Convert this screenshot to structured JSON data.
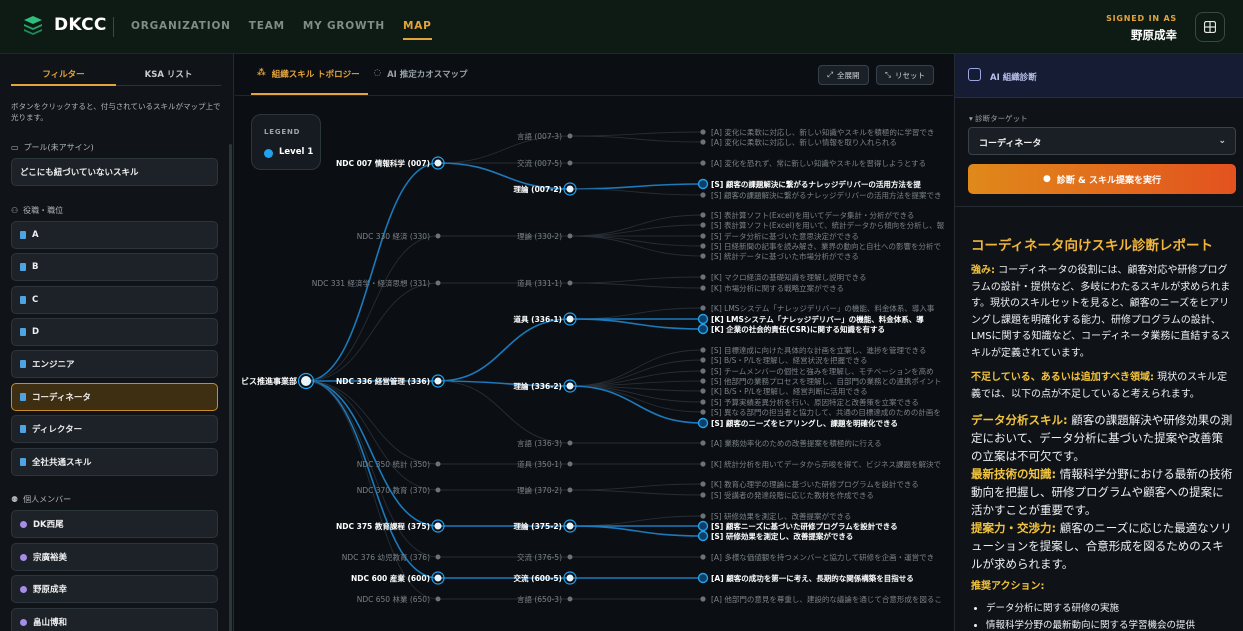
{
  "app": {
    "brand": "DKCC",
    "nav": [
      "ORGANIZATION",
      "TEAM",
      "MY GROWTH",
      "MAP"
    ],
    "active_nav": "MAP",
    "signed_in_label": "SIGNED IN AS",
    "user_name": "野原成幸"
  },
  "sidebar": {
    "tabs": [
      "フィルター",
      "KSA リスト"
    ],
    "help": "ボタンをクリックすると、付与されているスキルがマップ上で光ります。",
    "pool_label": "プール(未アサイン)",
    "pool_item": "どこにも紐づいていないスキル",
    "roles_label": "役職・職位",
    "roles": [
      "A",
      "B",
      "C",
      "D",
      "エンジニア",
      "コーディネータ",
      "ディレクター",
      "全社共通スキル"
    ],
    "selected_role": "コーディネータ",
    "members_label": "個人メンバー",
    "members": [
      "DK西尾",
      "宗廣裕美",
      "野原成幸",
      "畠山博和"
    ]
  },
  "main": {
    "tabs": [
      "組織スキル トポロジー",
      "AI 推定カオスマップ"
    ],
    "buttons": {
      "overview": "全展開",
      "reset": "リセット"
    },
    "legend_title": "LEGEND",
    "legend_item": "Level 1"
  },
  "graph": {
    "root": "ビス推進事業部",
    "l1": [
      {
        "label": "NDC 007 情報科学 (007)",
        "bold": true
      },
      {
        "label": "NDC 330 経済 (330)",
        "bold": false
      },
      {
        "label": "NDC 331 経済学・経済思想 (331)",
        "bold": false
      },
      {
        "label": "NDC 336 経営管理 (336)",
        "bold": true
      },
      {
        "label": "NDC 350 統計 (350)",
        "bold": false
      },
      {
        "label": "NDC 370 教育 (370)",
        "bold": false
      },
      {
        "label": "NDC 375 教育課程 (375)",
        "bold": true
      },
      {
        "label": "NDC 376 幼児教育 (376)",
        "bold": false
      },
      {
        "label": "NDC 600 産業 (600)",
        "bold": true
      },
      {
        "label": "NDC 650 林業 (650)",
        "bold": false
      }
    ],
    "l2": [
      {
        "label": "言語 (007-3)",
        "bold": false
      },
      {
        "label": "交流 (007-5)",
        "bold": false
      },
      {
        "label": "理論 (007-2)",
        "bold": true
      },
      {
        "label": "理論 (330-2)",
        "bold": false
      },
      {
        "label": "道具 (331-1)",
        "bold": false
      },
      {
        "label": "道具 (336-1)",
        "bold": true
      },
      {
        "label": "理論 (336-2)",
        "bold": true
      },
      {
        "label": "言語 (336-3)",
        "bold": false
      },
      {
        "label": "道具 (350-1)",
        "bold": false
      },
      {
        "label": "理論 (370-2)",
        "bold": false
      },
      {
        "label": "理論 (375-2)",
        "bold": true
      },
      {
        "label": "交流 (376-5)",
        "bold": false
      },
      {
        "label": "交流 (600-5)",
        "bold": true
      },
      {
        "label": "言語 (650-3)",
        "bold": false
      }
    ],
    "leaves": [
      {
        "label": "[A] 変化に柔軟に対応し、新しい知識やスキルを積極的に学習でき",
        "bold": false
      },
      {
        "label": "[A] 変化に柔軟に対応し、新しい情報を取り入れられる",
        "bold": false
      },
      {
        "label": "[A] 変化を恐れず、常に新しい知識やスキルを習得しようとする",
        "bold": false
      },
      {
        "label": "[S] 顧客の課題解決に繋がるナレッジデリバーの活用方法を提",
        "bold": true
      },
      {
        "label": "[S] 顧客の課題解決に繋がるナレッジデリバーの活用方法を提案でき",
        "bold": false
      },
      {
        "label": "[S] 表計算ソフト(Excel)を用いてデータ集計・分析ができる",
        "bold": false
      },
      {
        "label": "[S] 表計算ソフト(Excel)を用いて、統計データから傾向を分析し、報",
        "bold": false
      },
      {
        "label": "[S] データ分析に基づいた意思決定ができる",
        "bold": false
      },
      {
        "label": "[S] 日経新聞の記事を読み解き、業界の動向と自社への影響を分析で",
        "bold": false
      },
      {
        "label": "[S] 統計データに基づいた市場分析ができる",
        "bold": false
      },
      {
        "label": "[K] マクロ経済の基礎知識を理解し説明できる",
        "bold": false
      },
      {
        "label": "[K] 市場分析に関する戦略立案ができる",
        "bold": false
      },
      {
        "label": "[K] LMSシステム「ナレッジデリバー」の機能、料金体系、導入事",
        "bold": false
      },
      {
        "label": "[K] LMSシステム「ナレッジデリバー」の機能、料金体系、導",
        "bold": true
      },
      {
        "label": "[K] 企業の社会的責任(CSR)に関する知識を有する",
        "bold": true
      },
      {
        "label": "[S] 目標達成に向けた具体的な計画を立案し、進捗を管理できる",
        "bold": false
      },
      {
        "label": "[S] B/S・P/Lを理解し、経営状況を把握できる",
        "bold": false
      },
      {
        "label": "[S] チームメンバーの個性と強みを理解し、モチベーションを高め",
        "bold": false
      },
      {
        "label": "[S] 他部門の業務プロセスを理解し、自部門の業務との連携ポイント",
        "bold": false
      },
      {
        "label": "[K] B/S・P/Lを理解し、経営判断に活用できる",
        "bold": false
      },
      {
        "label": "[S] 予算実績差異分析を行い、原因特定と改善策を立案できる",
        "bold": false
      },
      {
        "label": "[S] 異なる部門の担当者と協力して、共通の目標達成のための計画を",
        "bold": false
      },
      {
        "label": "[S] 顧客のニーズをヒアリングし、課題を明確化できる",
        "bold": true
      },
      {
        "label": "[A] 業務効率化のための改善提案を積極的に行える",
        "bold": false
      },
      {
        "label": "[K] 統計分析を用いてデータから示唆を得て、ビジネス課題を解決で",
        "bold": false
      },
      {
        "label": "[K] 教育心理学の理論に基づいた研修プログラムを設計できる",
        "bold": false
      },
      {
        "label": "[S] 受講者の発達段階に応じた教材を作成できる",
        "bold": false
      },
      {
        "label": "[S] 研修効果を測定し、改善提案ができる",
        "bold": false
      },
      {
        "label": "[S] 顧客ニーズに基づいた研修プログラムを設計できる",
        "bold": true
      },
      {
        "label": "[S] 研修効果を測定し、改善提案ができる",
        "bold": true
      },
      {
        "label": "[A] 多様な価値観を持つメンバーと協力して研修を企画・運営でき",
        "bold": false
      },
      {
        "label": "[A] 顧客の成功を第一に考え、長期的な関係構築を目指せる",
        "bold": true
      },
      {
        "label": "[A] 他部門の意見を尊重し、建設的な議論を通じて合意形成を図るこ",
        "bold": false
      }
    ]
  },
  "panel": {
    "title": "AI 組織診断",
    "target_label": "診断ターゲット",
    "target_value": "コーディネータ",
    "run_button": "診断 & スキル提案を実行",
    "report": {
      "title": "コーディネータ向けスキル診断レポート",
      "strength_head": "強み:",
      "strength_body": " コーディネータの役割には、顧客対応や研修プログラムの設計・提供など、多岐にわたるスキルが求められます。現状のスキルセットを見ると、顧客のニーズをヒアリングし課題を明確化する能力、研修プログラムの設計、LMSに関する知識など、コーディネータ業務に直結するスキルが定義されています。",
      "gap_head": "不足している、あるいは追加すべき領域:",
      "gap_body": " 現状のスキル定義では、以下の点が不足していると考えられます。",
      "items": [
        {
          "head": "データ分析スキル:",
          "body": " 顧客の課題解決や研修効果の測定において、データ分析に基づいた提案や改善策の立案は不可欠です。"
        },
        {
          "head": "最新技術の知識:",
          "body": " 情報科学分野における最新の技術動向を把握し、研修プログラムや顧客への提案に活かすことが重要です。"
        },
        {
          "head": "提案力・交渉力:",
          "body": " 顧客のニーズに応じた最適なソリューションを提案し、合意形成を図るためのスキルが求められます。"
        }
      ],
      "action_head": "推奨アクション:",
      "actions": [
        "データ分析に関する研修の実施",
        "情報科学分野の最新動向に関する学習機会の提供"
      ]
    }
  },
  "colors": {
    "accent": "#e3a43c",
    "node": "#1fa3ef",
    "edge": "#1d7fc4"
  }
}
